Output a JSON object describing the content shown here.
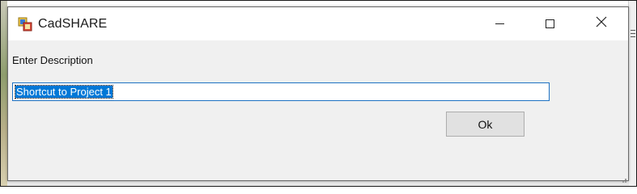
{
  "window": {
    "title": "CadSHARE",
    "icon": "cadshare-app-icon",
    "controls": {
      "minimize_icon": "minimize-icon",
      "maximize_icon": "maximize-icon",
      "close_icon": "close-icon"
    }
  },
  "form": {
    "label": "Enter Description",
    "description_value": "Shortcut to Project 1",
    "ok_label": "Ok"
  },
  "colors": {
    "selection": "#0078d7",
    "focus_border": "#1e72c3",
    "dialog_bg": "#f0f0f0",
    "titlebar_bg": "#ffffff",
    "button_bg": "#e1e1e1"
  }
}
